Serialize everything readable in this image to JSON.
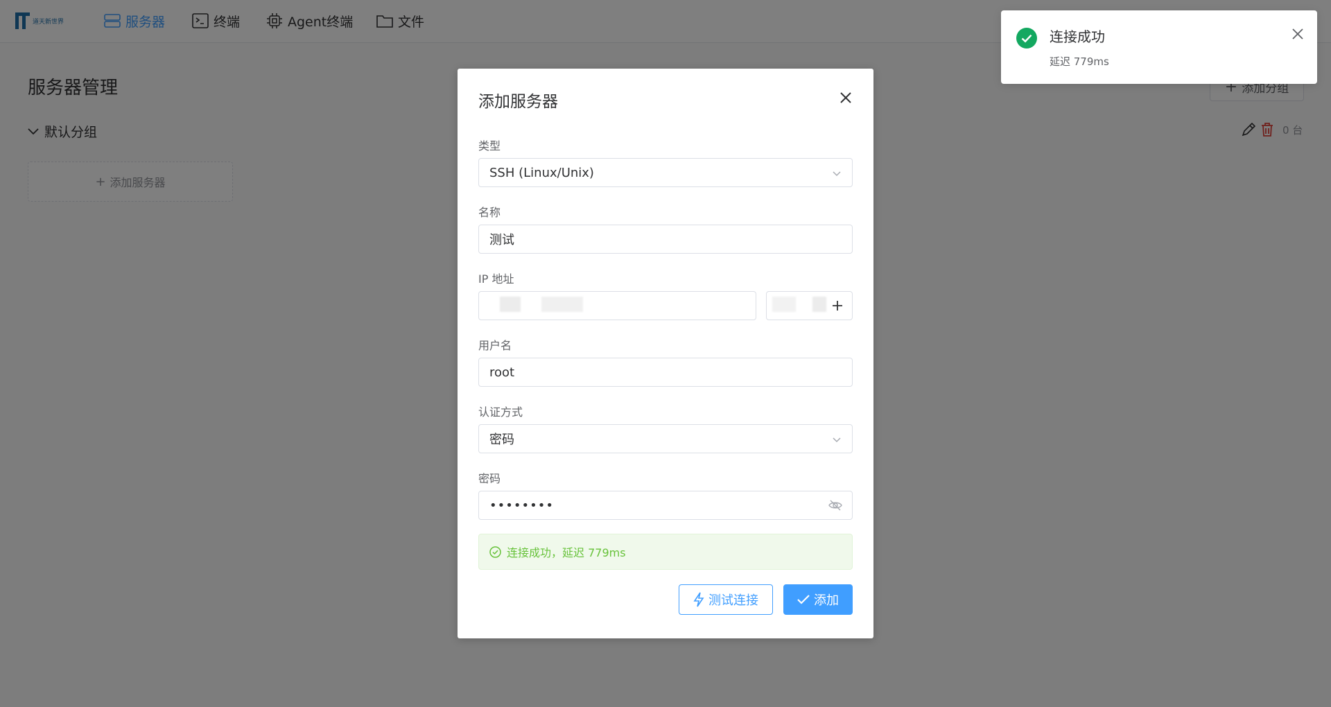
{
  "app": {
    "logo_text": "道天新世界"
  },
  "nav": {
    "items": [
      {
        "label": "服务器",
        "icon": "server-icon",
        "active": true
      },
      {
        "label": "终端",
        "icon": "terminal-icon",
        "active": false
      },
      {
        "label": "Agent终端",
        "icon": "chip-icon",
        "active": false
      },
      {
        "label": "文件",
        "icon": "folder-icon",
        "active": false
      }
    ]
  },
  "page": {
    "title": "服务器管理",
    "add_group_label": "添加分组",
    "group_name": "默认分组",
    "group_count": "0 台",
    "add_server_label": "添加服务器"
  },
  "dialog": {
    "title": "添加服务器",
    "type_label": "类型",
    "type_value": "SSH (Linux/Unix)",
    "name_label": "名称",
    "name_value": "测试",
    "ip_label": "IP 地址",
    "username_label": "用户名",
    "username_value": "root",
    "auth_label": "认证方式",
    "auth_value": "密码",
    "password_label": "密码",
    "password_value": "••••••••",
    "alert_text": "连接成功，延迟 779ms",
    "test_button": "测试连接",
    "add_button": "添加"
  },
  "toast": {
    "title": "连接成功",
    "message": "延迟 779ms"
  },
  "colors": {
    "primary": "#409eff",
    "success": "#67c23a",
    "toast_success": "#13a860"
  }
}
